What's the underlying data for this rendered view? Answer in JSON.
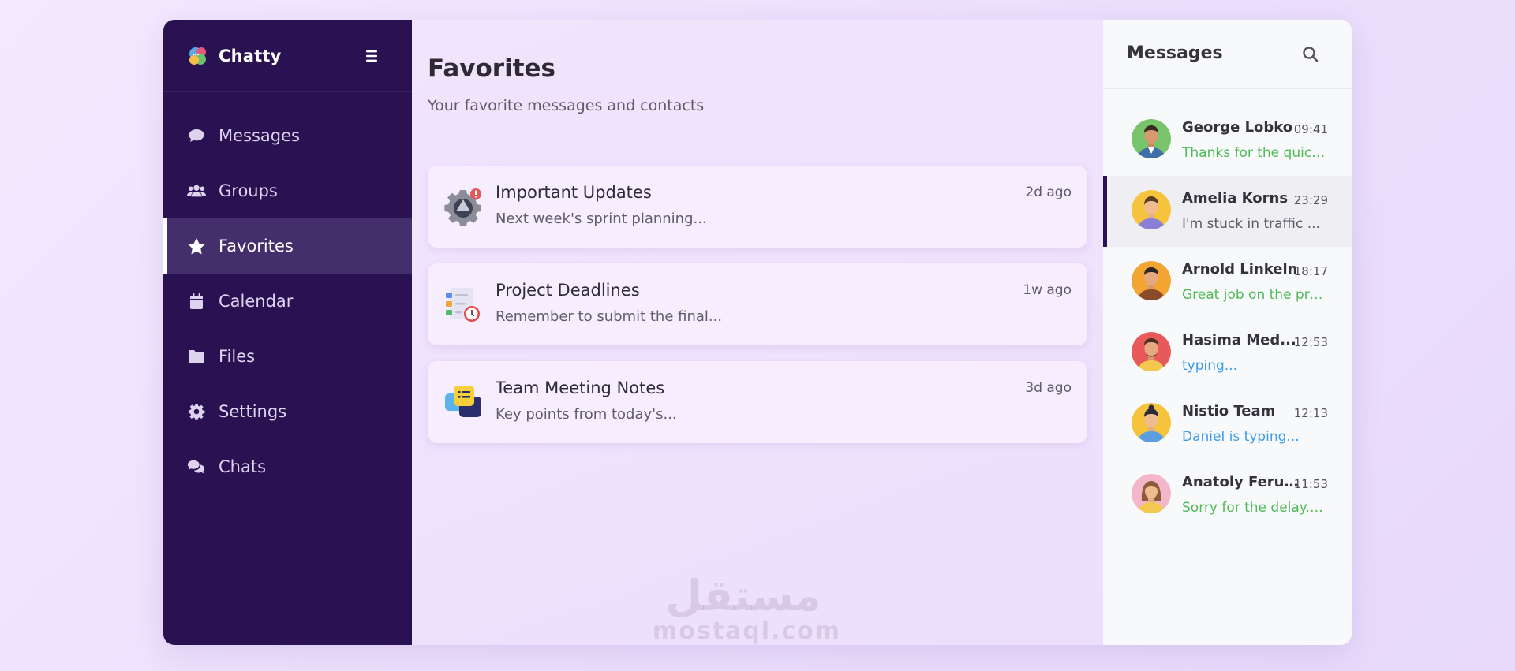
{
  "app": {
    "name": "Chatty"
  },
  "sidebar": {
    "items": [
      {
        "label": "Messages",
        "icon": "comment-icon"
      },
      {
        "label": "Groups",
        "icon": "users-icon"
      },
      {
        "label": "Favorites",
        "icon": "star-icon",
        "active": true
      },
      {
        "label": "Calendar",
        "icon": "calendar-icon"
      },
      {
        "label": "Files",
        "icon": "folder-icon"
      },
      {
        "label": "Settings",
        "icon": "gear-icon"
      },
      {
        "label": "Chats",
        "icon": "chats-icon"
      }
    ]
  },
  "main": {
    "title": "Favorites",
    "subtitle": "Your favorite messages and contacts",
    "cards": [
      {
        "title": "Important Updates",
        "preview": "Next week's sprint planning...",
        "time": "2d ago",
        "icon": "gear-alert-icon"
      },
      {
        "title": "Project Deadlines",
        "preview": "Remember to submit the final...",
        "time": "1w ago",
        "icon": "checklist-clock-icon"
      },
      {
        "title": "Team Meeting Notes",
        "preview": "Key points from today's...",
        "time": "3d ago",
        "icon": "notes-chat-icon"
      }
    ]
  },
  "watermark": {
    "arabic": "مستقل",
    "latin": "mostaql.com"
  },
  "panel": {
    "title": "Messages",
    "messages": [
      {
        "name": "George Lobko",
        "time": "09:41",
        "preview": "Thanks for the quick...",
        "preview_style": "green"
      },
      {
        "name": "Amelia Korns",
        "time": "23:29",
        "preview": "I'm stuck in traffic ...",
        "preview_style": "gray",
        "active": true
      },
      {
        "name": "Arnold Linkeln",
        "time": "18:17",
        "preview": "Great job on the pre...",
        "preview_style": "green"
      },
      {
        "name": "Hasima Med...",
        "time": "12:53",
        "preview": "typing...",
        "preview_style": "blue"
      },
      {
        "name": "Nistio Team",
        "time": "12:13",
        "preview": "Daniel is typing...",
        "preview_style": "blue"
      },
      {
        "name": "Anatoly Ferus...",
        "time": "11:53",
        "preview": "Sorry for the delay. I'...",
        "preview_style": "green"
      }
    ]
  },
  "colors": {
    "sidebar_bg": "#2a1152",
    "sidebar_active": "#442e6b",
    "preview_green": "#4fba57",
    "preview_blue": "#3c9be8"
  }
}
